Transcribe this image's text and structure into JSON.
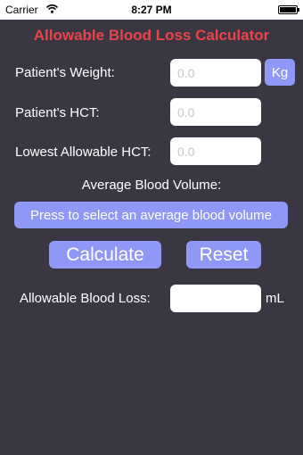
{
  "status_bar": {
    "carrier": "Carrier",
    "time": "8:27 PM"
  },
  "title": "Allowable Blood Loss Calculator",
  "fields": {
    "weight": {
      "label": "Patient's Weight:",
      "placeholder": "0.0",
      "unit_button": "Kg"
    },
    "hct": {
      "label": "Patient's HCT:",
      "placeholder": "0.0"
    },
    "lowest_hct": {
      "label": "Lowest Allowable HCT:",
      "placeholder": "0.0"
    }
  },
  "blood_volume": {
    "heading": "Average Blood Volume:",
    "button": "Press to select an average blood volume"
  },
  "actions": {
    "calculate": "Calculate",
    "reset": "Reset"
  },
  "result": {
    "label": "Allowable Blood Loss:",
    "value": "",
    "unit": "mL"
  },
  "colors": {
    "title": "#e8454c",
    "button": "#8f98f6",
    "background": "#3a3742"
  },
  "icons": {
    "wifi": "wifi-icon",
    "battery": "battery-icon"
  }
}
